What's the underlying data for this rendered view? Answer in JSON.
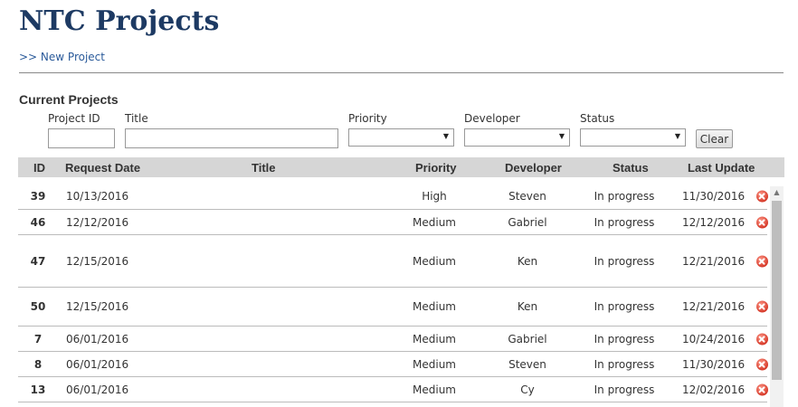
{
  "header": {
    "title": "NTC Projects",
    "new_project_link": ">> New Project"
  },
  "filters": {
    "section_title": "Current Projects",
    "project_id_label": "Project ID",
    "title_label": "Title",
    "priority_label": "Priority",
    "developer_label": "Developer",
    "status_label": "Status",
    "project_id_value": "",
    "title_value": "",
    "priority_selected": "",
    "developer_selected": "",
    "status_selected": "",
    "clear_label": "Clear"
  },
  "table": {
    "columns": [
      "ID",
      "Request Date",
      "Title",
      "Priority",
      "Developer",
      "Status",
      "Last Update"
    ],
    "rows": [
      {
        "id": "39",
        "request_date": "10/13/2016",
        "title": "",
        "priority": "High",
        "developer": "Steven",
        "status": "In progress",
        "last_update": "11/30/2016"
      },
      {
        "id": "46",
        "request_date": "12/12/2016",
        "title": "",
        "priority": "Medium",
        "developer": "Gabriel",
        "status": "In progress",
        "last_update": "12/12/2016"
      },
      {
        "id": "47",
        "request_date": "12/15/2016",
        "title": "",
        "priority": "Medium",
        "developer": "Ken",
        "status": "In progress",
        "last_update": "12/21/2016"
      },
      {
        "id": "50",
        "request_date": "12/15/2016",
        "title": "",
        "priority": "Medium",
        "developer": "Ken",
        "status": "In progress",
        "last_update": "12/21/2016"
      },
      {
        "id": "7",
        "request_date": "06/01/2016",
        "title": "",
        "priority": "Medium",
        "developer": "Gabriel",
        "status": "In progress",
        "last_update": "10/24/2016"
      },
      {
        "id": "8",
        "request_date": "06/01/2016",
        "title": "",
        "priority": "Medium",
        "developer": "Steven",
        "status": "In progress",
        "last_update": "11/30/2016"
      },
      {
        "id": "13",
        "request_date": "06/01/2016",
        "title": "",
        "priority": "Medium",
        "developer": "Cy",
        "status": "In progress",
        "last_update": "12/02/2016"
      }
    ]
  },
  "icons": {
    "delete": "delete-icon",
    "select_caret": "caret-down-icon",
    "scroll_up": "scroll-up-icon"
  },
  "colors": {
    "title": "#1d3a63",
    "link": "#2a5a9a",
    "header_bg": "#d6d6d6",
    "delete": "#d63a2a"
  }
}
